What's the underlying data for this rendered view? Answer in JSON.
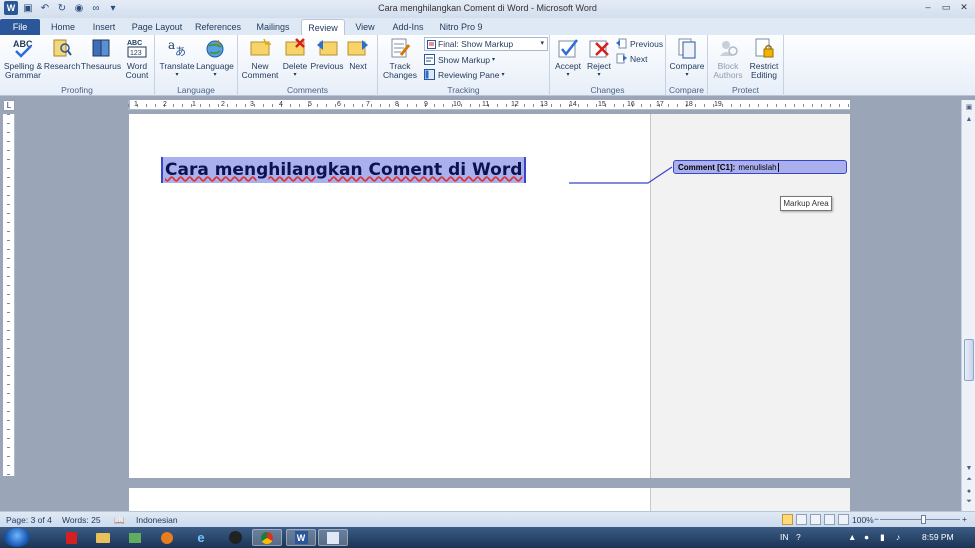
{
  "window": {
    "title": "Cara menghilangkan Coment di Word - Microsoft Word"
  },
  "tabs": [
    "File",
    "Home",
    "Insert",
    "Page Layout",
    "References",
    "Mailings",
    "Review",
    "View",
    "Add-Ins",
    "Nitro Pro 9"
  ],
  "ribbon": {
    "proofing": {
      "label": "Proofing",
      "spelling": "Spelling &\nGrammar",
      "research": "Research",
      "thesaurus": "Thesaurus",
      "word_count": "Word\nCount"
    },
    "language": {
      "label": "Language",
      "translate": "Translate",
      "language": "Language"
    },
    "comments": {
      "label": "Comments",
      "new": "New\nComment",
      "delete": "Delete",
      "previous": "Previous",
      "next": "Next"
    },
    "tracking": {
      "label": "Tracking",
      "track_changes": "Track\nChanges",
      "display_for_review": "Final: Show Markup",
      "show_markup": "Show Markup",
      "reviewing_pane": "Reviewing Pane"
    },
    "changes": {
      "label": "Changes",
      "accept": "Accept",
      "reject": "Reject",
      "previous": "Previous",
      "next": "Next"
    },
    "compare": {
      "label": "Compare",
      "compare": "Compare"
    },
    "protect": {
      "label": "Protect",
      "block_authors": "Block\nAuthors",
      "restrict_editing": "Restrict\nEditing"
    }
  },
  "document": {
    "heading": "Cara menghilangkan Coment di Word",
    "comment_label": "Comment [C1]:",
    "comment_text": "menulislah",
    "tooltip": "Markup Area",
    "ruler_numbers": [
      "1",
      "2",
      "1",
      "2",
      "3",
      "4",
      "5",
      "6",
      "7",
      "8",
      "9",
      "10",
      "11",
      "12",
      "13",
      "14",
      "15",
      "16",
      "17",
      "18",
      "19"
    ]
  },
  "status": {
    "page": "Page: 3 of 4",
    "words": "Words: 25",
    "language": "Indonesian",
    "zoom": "100%",
    "zoom_level": 1.0
  },
  "taskbar": {
    "tray_lang": "IN",
    "clock": "8:59 PM"
  },
  "colors": {
    "highlight": "#aab0ee",
    "comment_border": "#3a46c8",
    "ribbon_bg": "#e7eef8",
    "file_tab": "#2b579a"
  }
}
